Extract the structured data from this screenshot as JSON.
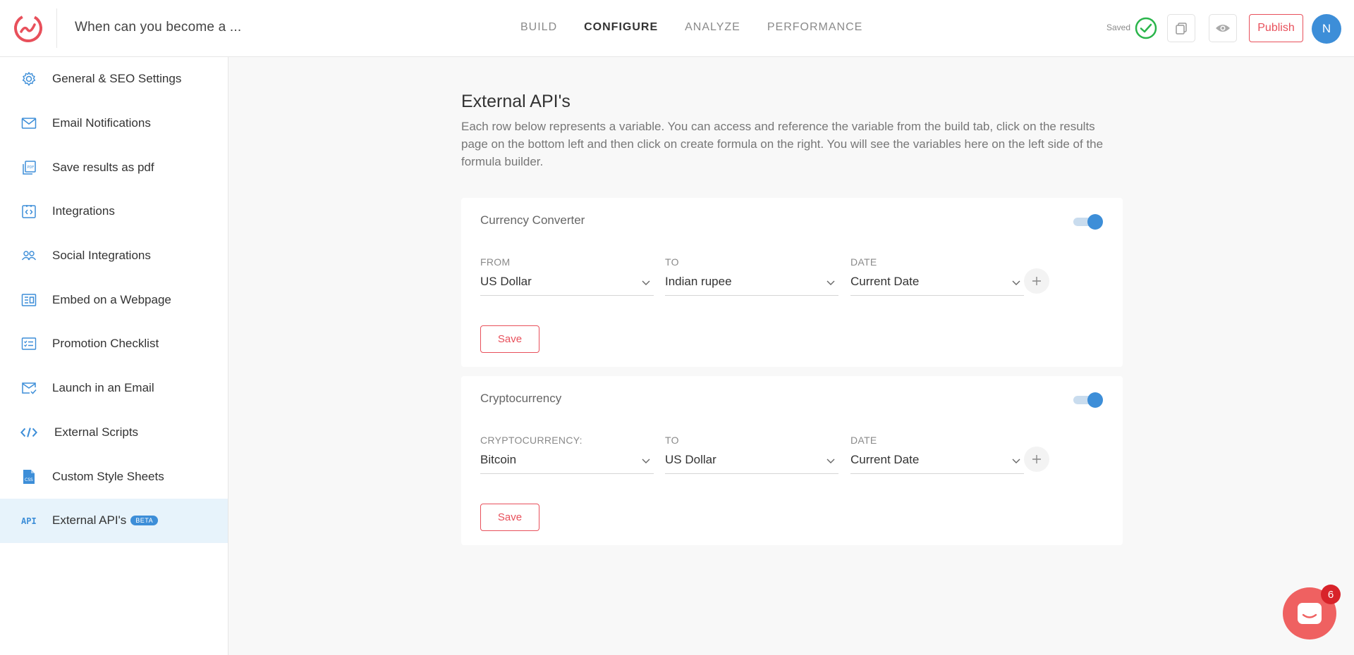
{
  "header": {
    "quiz_title": "When can you become a ...",
    "tabs": [
      {
        "label": "BUILD"
      },
      {
        "label": "CONFIGURE"
      },
      {
        "label": "ANALYZE"
      },
      {
        "label": "PERFORMANCE"
      }
    ],
    "active_tab": "CONFIGURE",
    "saved_label": "Saved",
    "publish_label": "Publish",
    "avatar_initial": "N"
  },
  "sidebar": {
    "items": [
      {
        "label": "General & SEO Settings",
        "icon": "gear-icon"
      },
      {
        "label": "Email Notifications",
        "icon": "envelope-icon"
      },
      {
        "label": "Save results as pdf",
        "icon": "pdf-icon"
      },
      {
        "label": "Integrations",
        "icon": "integrations-icon"
      },
      {
        "label": "Social Integrations",
        "icon": "people-icon"
      },
      {
        "label": "Embed on a Webpage",
        "icon": "embed-icon"
      },
      {
        "label": "Promotion Checklist",
        "icon": "checklist-icon"
      },
      {
        "label": "Launch in an Email",
        "icon": "email-check-icon"
      },
      {
        "label": "External Scripts",
        "icon": "code-icon"
      },
      {
        "label": "Custom Style Sheets",
        "icon": "css-file-icon"
      },
      {
        "label": "External API's",
        "icon": "api-icon",
        "badge": "BETA",
        "active": true
      }
    ]
  },
  "main": {
    "title": "External API's",
    "description": "Each row below represents a variable. You can access and reference the variable from the build tab, click on the results page on the bottom left and then click on create formula on the right. You will see the variables here on the left side of the formula builder.",
    "cards": [
      {
        "title": "Currency Converter",
        "enabled": true,
        "fields": [
          {
            "label": "FROM",
            "value": "US Dollar"
          },
          {
            "label": "TO",
            "value": "Indian rupee"
          },
          {
            "label": "DATE",
            "value": "Current Date"
          }
        ],
        "save_label": "Save"
      },
      {
        "title": "Cryptocurrency",
        "enabled": true,
        "fields": [
          {
            "label": "CRYPTOCURRENCY:",
            "value": "Bitcoin"
          },
          {
            "label": "TO",
            "value": "US Dollar"
          },
          {
            "label": "DATE",
            "value": "Current Date"
          }
        ],
        "save_label": "Save"
      }
    ]
  },
  "chat": {
    "unread_count": "6"
  },
  "colors": {
    "accent": "#3d8ed8",
    "brand": "#e8505b",
    "success": "#2ab54b"
  }
}
